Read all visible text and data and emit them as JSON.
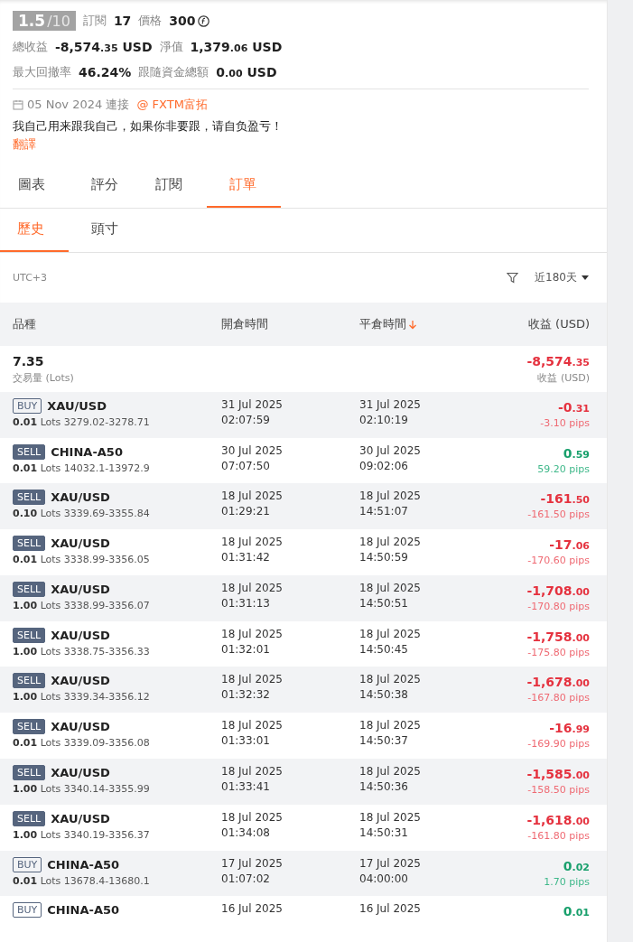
{
  "profile": {
    "rating": "1.5",
    "rating_max": "/10",
    "subscribers_label": "訂閱",
    "subscribers": "17",
    "price_label": "價格",
    "price": "300",
    "stats": [
      {
        "label": "總收益",
        "whole": "-8,574",
        "fraction": ".35",
        "unit": "USD"
      },
      {
        "label": "淨值",
        "whole": "1,379",
        "fraction": ".06",
        "unit": "USD"
      }
    ],
    "stats2": [
      {
        "label": "最大回撤率",
        "whole": "46.24%"
      },
      {
        "label": "跟隨資金總額",
        "whole": "0",
        "fraction": ".00",
        "unit": "USD"
      }
    ],
    "joined": "05 Nov 2024 連接",
    "broker": "@ FXTM富拓",
    "description": "我自己用来跟我自己，如果你非要跟，请自负盈亏！",
    "translate": "翻譯"
  },
  "tabs": [
    {
      "label": "圖表",
      "selected": false
    },
    {
      "label": "評分",
      "selected": false
    },
    {
      "label": "訂閱",
      "selected": false
    },
    {
      "label": "訂單",
      "selected": true
    }
  ],
  "subtabs": [
    {
      "label": "歷史",
      "selected": true
    },
    {
      "label": "頭寸",
      "selected": false
    }
  ],
  "timezone": "UTC+3",
  "period": "近180天",
  "table": {
    "columns": [
      "品種",
      "開倉時間",
      "平倉時間",
      "收益 (USD)"
    ],
    "summary": {
      "lots": "7.35",
      "lots_label": "交易量 (Lots)",
      "whole": "-8,574",
      "fraction": ".35",
      "profit_label": "收益 (USD)"
    },
    "rows": [
      {
        "side": "BUY",
        "kind": "buy",
        "symbol": "XAU/USD",
        "lots": "0.01",
        "lots_unit": "Lots",
        "prices": "3279.02-3278.71",
        "open_date": "31 Jul 2025",
        "open_time": "02:07:59",
        "close_date": "31 Jul 2025",
        "close_time": "02:10:19",
        "whole": "-0",
        "fraction": ".31",
        "pips": "-3.10 pips",
        "gain": false
      },
      {
        "side": "SELL",
        "kind": "sell",
        "symbol": "CHINA-A50",
        "lots": "0.01",
        "lots_unit": "Lots",
        "prices": "14032.1-13972.9",
        "open_date": "30 Jul 2025",
        "open_time": "07:07:50",
        "close_date": "30 Jul 2025",
        "close_time": "09:02:06",
        "whole": "0",
        "fraction": ".59",
        "pips": "59.20 pips",
        "gain": true
      },
      {
        "side": "SELL",
        "kind": "sell",
        "symbol": "XAU/USD",
        "lots": "0.10",
        "lots_unit": "Lots",
        "prices": "3339.69-3355.84",
        "open_date": "18 Jul 2025",
        "open_time": "01:29:21",
        "close_date": "18 Jul 2025",
        "close_time": "14:51:07",
        "whole": "-161",
        "fraction": ".50",
        "pips": "-161.50 pips",
        "gain": false
      },
      {
        "side": "SELL",
        "kind": "sell",
        "symbol": "XAU/USD",
        "lots": "0.01",
        "lots_unit": "Lots",
        "prices": "3338.99-3356.05",
        "open_date": "18 Jul 2025",
        "open_time": "01:31:42",
        "close_date": "18 Jul 2025",
        "close_time": "14:50:59",
        "whole": "-17",
        "fraction": ".06",
        "pips": "-170.60 pips",
        "gain": false
      },
      {
        "side": "SELL",
        "kind": "sell",
        "symbol": "XAU/USD",
        "lots": "1.00",
        "lots_unit": "Lots",
        "prices": "3338.99-3356.07",
        "open_date": "18 Jul 2025",
        "open_time": "01:31:13",
        "close_date": "18 Jul 2025",
        "close_time": "14:50:51",
        "whole": "-1,708",
        "fraction": ".00",
        "pips": "-170.80 pips",
        "gain": false
      },
      {
        "side": "SELL",
        "kind": "sell",
        "symbol": "XAU/USD",
        "lots": "1.00",
        "lots_unit": "Lots",
        "prices": "3338.75-3356.33",
        "open_date": "18 Jul 2025",
        "open_time": "01:32:01",
        "close_date": "18 Jul 2025",
        "close_time": "14:50:45",
        "whole": "-1,758",
        "fraction": ".00",
        "pips": "-175.80 pips",
        "gain": false
      },
      {
        "side": "SELL",
        "kind": "sell",
        "symbol": "XAU/USD",
        "lots": "1.00",
        "lots_unit": "Lots",
        "prices": "3339.34-3356.12",
        "open_date": "18 Jul 2025",
        "open_time": "01:32:32",
        "close_date": "18 Jul 2025",
        "close_time": "14:50:38",
        "whole": "-1,678",
        "fraction": ".00",
        "pips": "-167.80 pips",
        "gain": false
      },
      {
        "side": "SELL",
        "kind": "sell",
        "symbol": "XAU/USD",
        "lots": "0.01",
        "lots_unit": "Lots",
        "prices": "3339.09-3356.08",
        "open_date": "18 Jul 2025",
        "open_time": "01:33:01",
        "close_date": "18 Jul 2025",
        "close_time": "14:50:37",
        "whole": "-16",
        "fraction": ".99",
        "pips": "-169.90 pips",
        "gain": false
      },
      {
        "side": "SELL",
        "kind": "sell",
        "symbol": "XAU/USD",
        "lots": "1.00",
        "lots_unit": "Lots",
        "prices": "3340.14-3355.99",
        "open_date": "18 Jul 2025",
        "open_time": "01:33:41",
        "close_date": "18 Jul 2025",
        "close_time": "14:50:36",
        "whole": "-1,585",
        "fraction": ".00",
        "pips": "-158.50 pips",
        "gain": false
      },
      {
        "side": "SELL",
        "kind": "sell",
        "symbol": "XAU/USD",
        "lots": "1.00",
        "lots_unit": "Lots",
        "prices": "3340.19-3356.37",
        "open_date": "18 Jul 2025",
        "open_time": "01:34:08",
        "close_date": "18 Jul 2025",
        "close_time": "14:50:31",
        "whole": "-1,618",
        "fraction": ".00",
        "pips": "-161.80 pips",
        "gain": false
      },
      {
        "side": "BUY",
        "kind": "buy",
        "symbol": "CHINA-A50",
        "lots": "0.01",
        "lots_unit": "Lots",
        "prices": "13678.4-13680.1",
        "open_date": "17 Jul 2025",
        "open_time": "01:07:02",
        "close_date": "17 Jul 2025",
        "close_time": "04:00:00",
        "whole": "0",
        "fraction": ".02",
        "pips": "1.70 pips",
        "gain": true
      },
      {
        "side": "BUY",
        "kind": "buy",
        "symbol": "CHINA-A50",
        "open_date": "16 Jul 2025",
        "close_date": "16 Jul 2025",
        "whole": "0",
        "fraction": ".01",
        "gain": true
      }
    ]
  }
}
